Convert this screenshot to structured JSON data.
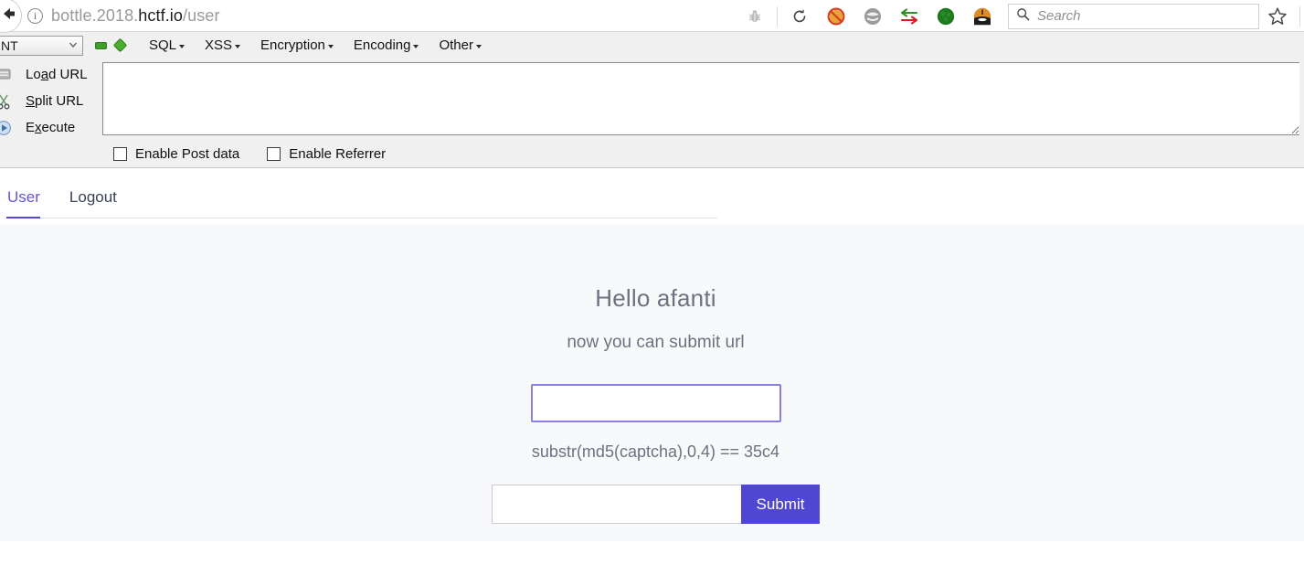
{
  "browser": {
    "back_icon": "back-arrow-icon",
    "site_info_icon": "info-icon",
    "url_prefix": "bottle.2018.",
    "url_domain": "hctf.io",
    "url_suffix": "/user",
    "full_url": "bottle.2018.hctf.io/user",
    "extensions": [
      {
        "name": "bug-icon",
        "glyph": "bug"
      },
      {
        "name": "reload-icon",
        "glyph": "reload"
      },
      {
        "name": "noscript-icon",
        "glyph": "noscript"
      },
      {
        "name": "wappalyzer-icon",
        "glyph": "wappalyzer"
      },
      {
        "name": "proxy-switcher-icon",
        "glyph": "arrows"
      },
      {
        "name": "green-extension-icon",
        "glyph": "green-circle"
      },
      {
        "name": "orange-extension-icon",
        "glyph": "orange-circle"
      }
    ],
    "search_placeholder": "Search",
    "search_icon": "search-icon",
    "bookmark_icon": "star-icon"
  },
  "hackbar": {
    "select_value": "NT",
    "menus": [
      {
        "label": "SQL"
      },
      {
        "label": "XSS"
      },
      {
        "label": "Encryption"
      },
      {
        "label": "Encoding"
      },
      {
        "label": "Other"
      }
    ],
    "actions": [
      {
        "label_pre": "Lo",
        "label_accel": "a",
        "label_post": "d URL",
        "icon": "load-url-icon"
      },
      {
        "label_pre": "",
        "label_accel": "S",
        "label_post": "plit URL",
        "icon": "split-url-icon"
      },
      {
        "label_pre": "E",
        "label_accel": "x",
        "label_post": "ecute",
        "icon": "execute-icon"
      }
    ],
    "url_textarea_value": "",
    "checkboxes": [
      {
        "label": "Enable Post data",
        "checked": false
      },
      {
        "label": "Enable Referrer",
        "checked": false
      }
    ]
  },
  "page": {
    "tabs": [
      {
        "label": "User",
        "active": true
      },
      {
        "label": "Logout",
        "active": false
      }
    ],
    "heading": "Hello afanti",
    "subtitle": "now you can submit url",
    "captcha_value": "",
    "captcha_placeholder": "",
    "captcha_hint": "substr(md5(captcha),0,4) == 35c4",
    "url_value": "",
    "url_placeholder": "",
    "submit_label": "Submit"
  },
  "colors": {
    "accent": "#5548d9",
    "submit_bg": "#4f46d4",
    "captcha_border": "#8b80e0",
    "text_muted": "#6b7280",
    "page_bg": "#f8f9fa"
  }
}
